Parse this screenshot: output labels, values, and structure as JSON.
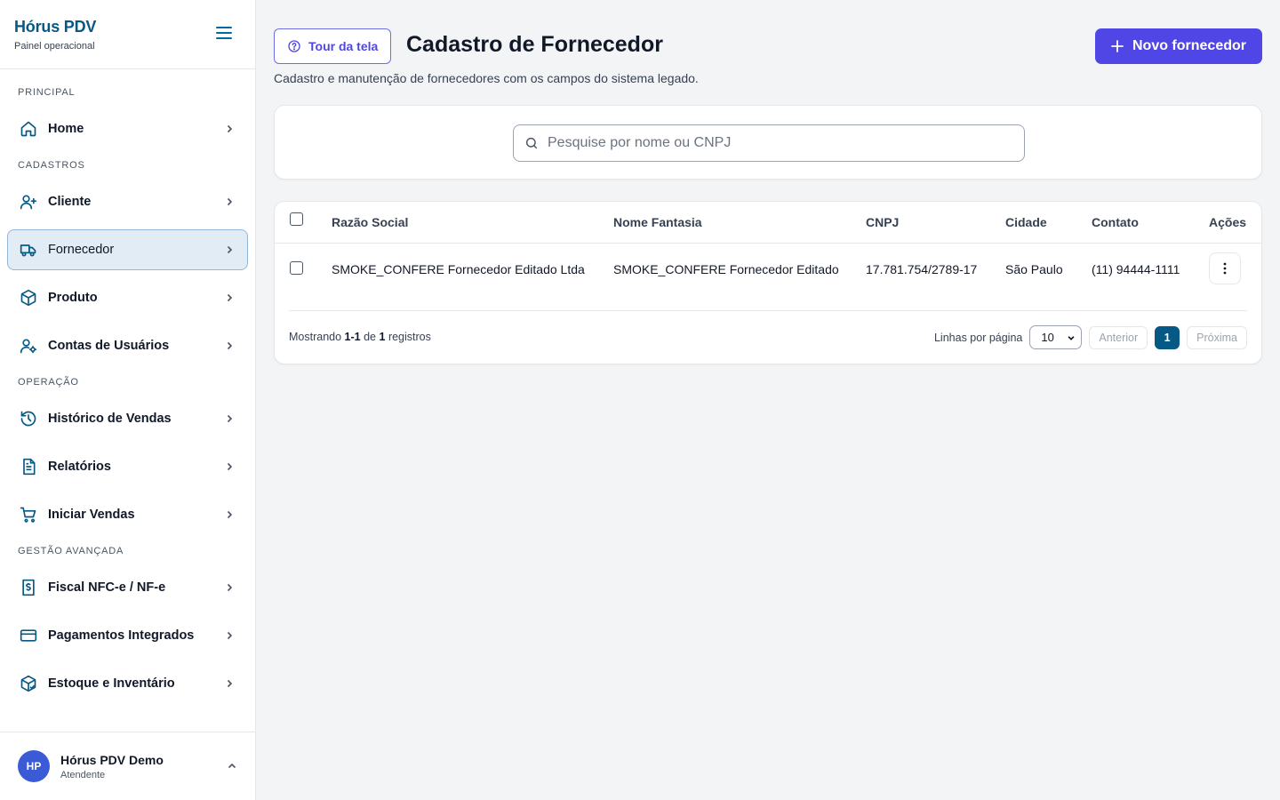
{
  "brand": {
    "title": "Hórus PDV",
    "subtitle": "Painel operacional"
  },
  "sidebar": {
    "sections": [
      {
        "label": "PRINCIPAL"
      },
      {
        "label": "CADASTROS"
      },
      {
        "label": "OPERAÇÃO"
      },
      {
        "label": "GESTÃO AVANÇADA"
      }
    ],
    "items": [
      {
        "label": "Home",
        "icon": "home-icon"
      },
      {
        "label": "Cliente",
        "icon": "user-plus-icon"
      },
      {
        "label": "Fornecedor",
        "icon": "truck-icon",
        "active": true
      },
      {
        "label": "Produto",
        "icon": "package-icon"
      },
      {
        "label": "Contas de Usuários",
        "icon": "user-gear-icon"
      },
      {
        "label": "Histórico de Vendas",
        "icon": "history-icon"
      },
      {
        "label": "Relatórios",
        "icon": "report-icon"
      },
      {
        "label": "Iniciar Vendas",
        "icon": "cart-icon"
      },
      {
        "label": "Fiscal NFC-e / NF-e",
        "icon": "fiscal-icon"
      },
      {
        "label": "Pagamentos Integrados",
        "icon": "credit-card-icon"
      },
      {
        "label": "Estoque e Inventário",
        "icon": "inventory-icon"
      }
    ]
  },
  "user": {
    "initials": "HP",
    "name": "Hórus PDV Demo",
    "role": "Atendente"
  },
  "header": {
    "tour_label": "Tour da tela",
    "title": "Cadastro de Fornecedor",
    "description": "Cadastro e manutenção de fornecedores com os campos do sistema legado.",
    "new_label": "Novo fornecedor"
  },
  "search": {
    "placeholder": "Pesquise por nome ou CNPJ",
    "value": ""
  },
  "table": {
    "columns": [
      "Razão Social",
      "Nome Fantasia",
      "CNPJ",
      "Cidade",
      "Contato",
      "Ações"
    ],
    "rows": [
      {
        "razao_social": "SMOKE_CONFERE Fornecedor Editado Ltda",
        "nome_fantasia": "SMOKE_CONFERE Fornecedor Editado",
        "cnpj": "17.781.754/2789-17",
        "cidade": "São Paulo",
        "contato": "(11) 94444-1111"
      }
    ]
  },
  "pagination": {
    "showing_prefix": "Mostrando",
    "range": "1-1",
    "of": "de",
    "total": "1",
    "suffix": "registros",
    "rows_per_page_label": "Linhas por página",
    "rows_per_page": "10",
    "prev_label": "Anterior",
    "current_page": "1",
    "next_label": "Próxima"
  },
  "colors": {
    "accent": "#4f46e5",
    "brand": "#075985",
    "active_bg": "#e2ecf5"
  }
}
